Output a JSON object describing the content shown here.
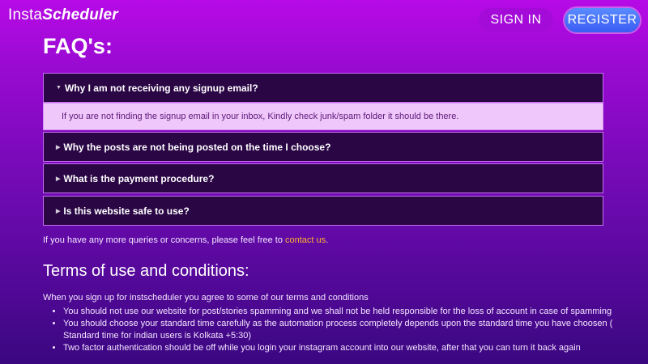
{
  "header": {
    "logo_plain": "Insta",
    "logo_bold": "Scheduler",
    "signin_label": "SIGN IN",
    "register_label": "REGISTER"
  },
  "faq": {
    "title": "FAQ's:",
    "items": [
      {
        "question": "Why I am not receiving any signup email?",
        "expanded": true,
        "answer": "If you are not finding the signup email in your inbox, Kindly check junk/spam folder it should be there."
      },
      {
        "question": "Why the posts are not being posted on the time I choose?",
        "expanded": false
      },
      {
        "question": "What is the payment procedure?",
        "expanded": false
      },
      {
        "question": "Is this website safe to use?",
        "expanded": false
      }
    ],
    "contact_prefix": "If you have any more queries or concerns, please feel free to ",
    "contact_link": "contact us",
    "contact_suffix": "."
  },
  "terms": {
    "title": "Terms of use and conditions:",
    "intro": "When you sign up for instscheduler you agree to some of our terms and conditions",
    "items": [
      "You should not use our website for post/stories spamming and we shall not be held responsible for the loss of account in case of spamming",
      "You should choose your standard time carefully as the automation process completely depends upon the standard time you have choosen ( Standard time for indian users is Kolkata +5:30)",
      "Two factor authentication should be off while you login your instagram account into our website, after that you can turn it back again"
    ]
  },
  "colors": {
    "accent_link": "#ffb02e",
    "register_button": "#3b5bf3",
    "signin_button": "#a40bd8",
    "faq_item_bg": "#2a0645",
    "faq_answer_bg": "#f0c7fb"
  }
}
